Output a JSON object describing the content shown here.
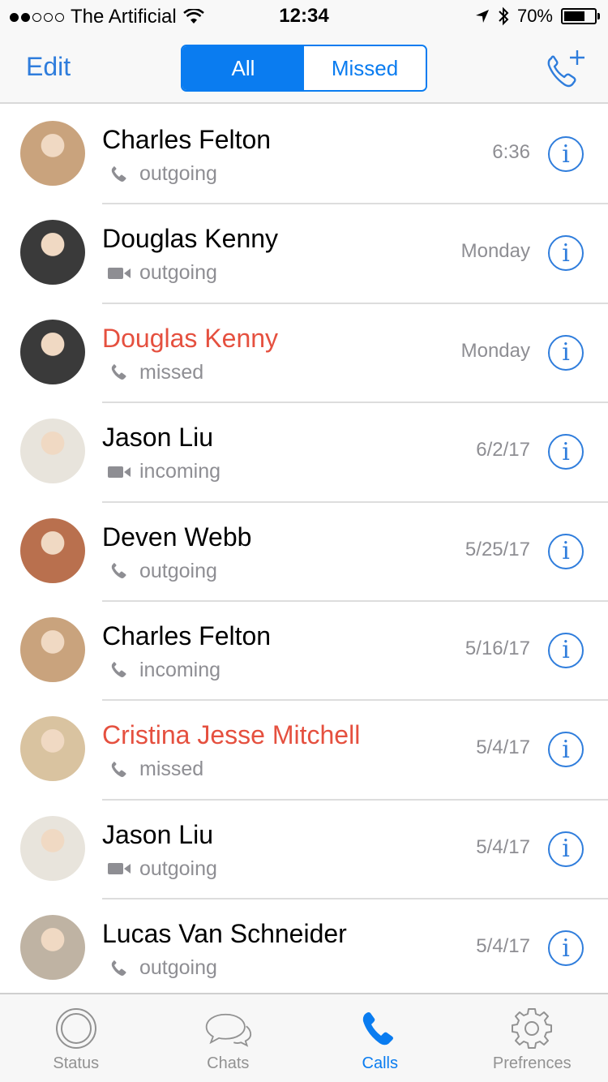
{
  "status_bar": {
    "carrier": "The Artificial",
    "time": "12:34",
    "battery": "70%",
    "battery_level": 0.7
  },
  "nav": {
    "edit_label": "Edit",
    "segments": [
      {
        "label": "All",
        "active": true
      },
      {
        "label": "Missed",
        "active": false
      }
    ]
  },
  "calls": [
    {
      "name": "Charles Felton",
      "type": "outgoing",
      "medium": "phone",
      "when": "6:36",
      "missed": false,
      "avatar_color": "#c9a37d"
    },
    {
      "name": "Douglas Kenny",
      "type": "outgoing",
      "medium": "video",
      "when": "Monday",
      "missed": false,
      "avatar_color": "#3a3a3a"
    },
    {
      "name": "Douglas Kenny",
      "type": "missed",
      "medium": "phone",
      "when": "Monday",
      "missed": true,
      "avatar_color": "#3a3a3a"
    },
    {
      "name": "Jason Liu",
      "type": "incoming",
      "medium": "video",
      "when": "6/2/17",
      "missed": false,
      "avatar_color": "#e8e4dc"
    },
    {
      "name": "Deven Webb",
      "type": "outgoing",
      "medium": "phone",
      "when": "5/25/17",
      "missed": false,
      "avatar_color": "#b9704e"
    },
    {
      "name": "Charles Felton",
      "type": "incoming",
      "medium": "phone",
      "when": "5/16/17",
      "missed": false,
      "avatar_color": "#c9a37d"
    },
    {
      "name": "Cristina Jesse Mitchell",
      "type": "missed",
      "medium": "phone",
      "when": "5/4/17",
      "missed": true,
      "avatar_color": "#d9c3a0"
    },
    {
      "name": "Jason Liu",
      "type": "outgoing",
      "medium": "video",
      "when": "5/4/17",
      "missed": false,
      "avatar_color": "#e8e4dc"
    },
    {
      "name": "Lucas Van Schneider",
      "type": "outgoing",
      "medium": "phone",
      "when": "5/4/17",
      "missed": false,
      "avatar_color": "#bfb3a3"
    }
  ],
  "tabs": [
    {
      "label": "Status",
      "icon": "status-icon",
      "active": false
    },
    {
      "label": "Chats",
      "icon": "chats-icon",
      "active": false
    },
    {
      "label": "Calls",
      "icon": "phone-icon",
      "active": true
    },
    {
      "label": "Prefrences",
      "icon": "gear-icon",
      "active": false
    }
  ],
  "colors": {
    "accent": "#0a7cf0",
    "link": "#2f7ddc",
    "missed": "#e5503f",
    "secondary_text": "#8e8e93"
  }
}
